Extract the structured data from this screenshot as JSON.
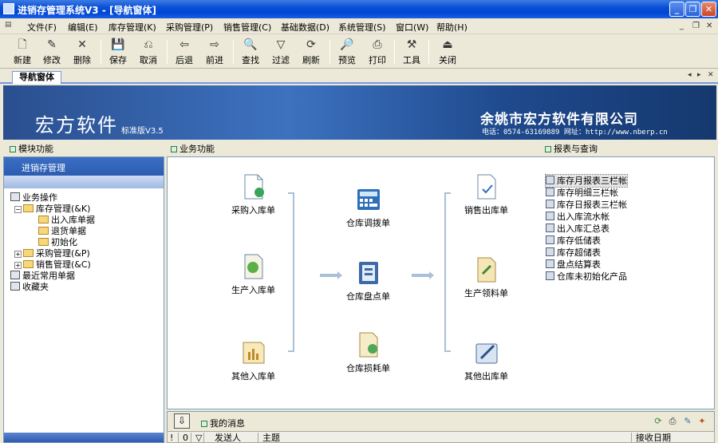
{
  "window": {
    "title": "进销存管理系统V3 - [导航窗体]",
    "buttons": [
      "_",
      "❐",
      "✕"
    ]
  },
  "menu": {
    "items": [
      "文件(F)",
      "编辑(E)",
      "库存管理(K)",
      "采购管理(P)",
      "销售管理(C)",
      "基础数据(D)",
      "系统管理(S)",
      "窗口(W)",
      "帮助(H)"
    ],
    "mdi_buttons": [
      "_",
      "❐",
      "✕"
    ]
  },
  "toolbar": {
    "buttons": [
      {
        "label": "新建",
        "icon": "🗋"
      },
      {
        "label": "修改",
        "icon": "✎"
      },
      {
        "label": "删除",
        "icon": "✕"
      },
      {
        "label": "保存",
        "icon": "💾"
      },
      {
        "label": "取消",
        "icon": "⎌"
      },
      {
        "label": "后退",
        "icon": "⇦"
      },
      {
        "label": "前进",
        "icon": "⇨"
      },
      {
        "label": "查找",
        "icon": "🔍"
      },
      {
        "label": "过滤",
        "icon": "▽"
      },
      {
        "label": "刷新",
        "icon": "⟳"
      },
      {
        "label": "预览",
        "icon": "🔎"
      },
      {
        "label": "打印",
        "icon": "⎙"
      },
      {
        "label": "工具",
        "icon": "⚒"
      },
      {
        "label": "关闭",
        "icon": "⏏"
      }
    ]
  },
  "tabs": {
    "active": "导航窗体",
    "nav": [
      "◂",
      "▸",
      "✕"
    ]
  },
  "banner": {
    "brand": "宏方软件",
    "version": "标准版V3.5",
    "company": "余姚市宏方软件有限公司",
    "contact": "电话：0574-63169889    网址：http://www.nberp.cn"
  },
  "sections": {
    "modules": "模块功能",
    "business": "业务功能",
    "reports": "报表与查询"
  },
  "module_panel": {
    "header": "进销存管理",
    "tree": {
      "business_ops": "业务操作",
      "inventory": "库存管理(&K)",
      "inout": "出入库单据",
      "returns": "退货单据",
      "init": "初始化",
      "purchase": "采购管理(&P)",
      "sales": "销售管理(&C)",
      "recent": "最近常用单据",
      "favorites": "收藏夹"
    }
  },
  "business": {
    "purchase_in": "采购入库单",
    "production_in": "生产入库单",
    "other_in": "其他入库单",
    "transfer": "仓库调拨单",
    "stocktake": "仓库盘点单",
    "loss": "仓库损耗单",
    "sales_out": "销售出库单",
    "production_pick": "生产领料单",
    "other_out": "其他出库单"
  },
  "reports": [
    "库存月报表三栏帐",
    "库存明细三栏帐",
    "库存日报表三栏帐",
    "出入库流水帐",
    "出入库汇总表",
    "库存低储表",
    "库存超储表",
    "盘点结算表",
    "仓库未初始化产品"
  ],
  "messages": {
    "label": "我的消息",
    "down_icon": "⇩",
    "columns": [
      "!",
      "0",
      "▽",
      "发送人",
      "主题",
      "接收日期"
    ]
  }
}
